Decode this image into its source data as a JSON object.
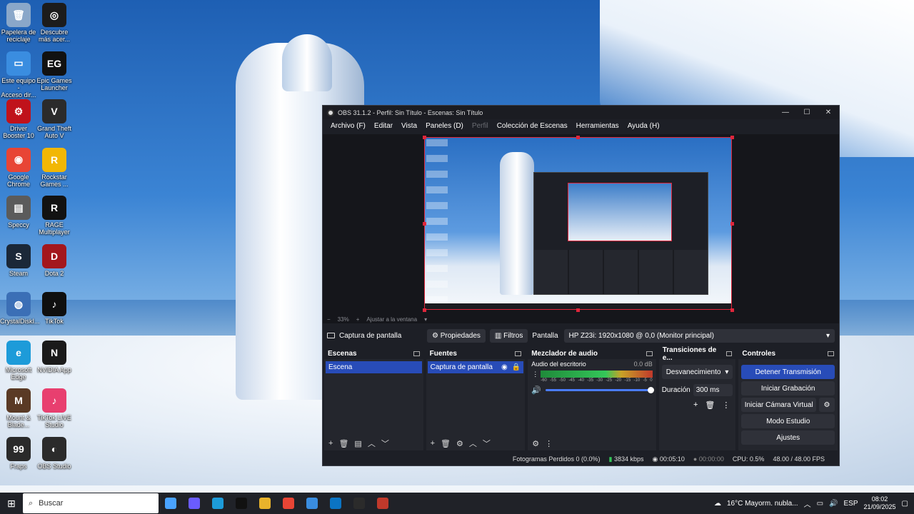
{
  "desktop": {
    "icons": [
      {
        "label": "Papelera de\nreciclaje",
        "color": "#8aa7c9",
        "glyph": "🗑"
      },
      {
        "label": "Descubre\nmás acer...",
        "color": "#1c1c1c",
        "glyph": "◎"
      },
      {
        "label": "Este equipo -\nAcceso dir...",
        "color": "#3a8de0",
        "glyph": "▭"
      },
      {
        "label": "Epic Games\nLauncher",
        "color": "#111111",
        "glyph": "EG"
      },
      {
        "label": "Driver\nBooster 10",
        "color": "#c0121b",
        "glyph": "⚙"
      },
      {
        "label": "Grand Theft\nAuto V",
        "color": "#2b2b2b",
        "glyph": "V"
      },
      {
        "label": "Google\nChrome",
        "color": "#e84535",
        "glyph": "◉"
      },
      {
        "label": "Rockstar\nGames ...",
        "color": "#f2b705",
        "glyph": "R"
      },
      {
        "label": "Speccy",
        "color": "#5b5b5b",
        "glyph": "▤"
      },
      {
        "label": "RAGE\nMultiplayer",
        "color": "#121212",
        "glyph": "R"
      },
      {
        "label": "Steam",
        "color": "#1b2838",
        "glyph": "S"
      },
      {
        "label": "Dota 2",
        "color": "#a3171d",
        "glyph": "D"
      },
      {
        "label": "CrystalDiskI...",
        "color": "#3b6fb6",
        "glyph": "◍"
      },
      {
        "label": "TikTok",
        "color": "#0f0f0f",
        "glyph": "♪"
      },
      {
        "label": "Microsoft\nEdge",
        "color": "#1d9bd9",
        "glyph": "e"
      },
      {
        "label": "NVIDIA App",
        "color": "#1a1a1a",
        "glyph": "N"
      },
      {
        "label": "Mount &\nBlade...",
        "color": "#5a3a25",
        "glyph": "M"
      },
      {
        "label": "TikTok LIVE\nStudio",
        "color": "#e83f6f",
        "glyph": "♪"
      },
      {
        "label": "Fraps",
        "color": "#2a2a2a",
        "glyph": "99"
      },
      {
        "label": "OBS Studio",
        "color": "#2b2b2b",
        "glyph": "◐"
      }
    ]
  },
  "obs": {
    "title": "OBS 31.1.2 - Perfil: Sin Título - Escenas: Sin Título",
    "menu": [
      "Archivo (F)",
      "Editar",
      "Vista",
      "Paneles (D)",
      "Perfil",
      "Colección de Escenas",
      "Herramientas",
      "Ayuda (H)"
    ],
    "zoom": {
      "minus": "−",
      "value": "33%",
      "plus": "+",
      "fit": "Ajustar a la ventana",
      "arrow": "▾"
    },
    "source_bar": {
      "source_name": "Captura de pantalla",
      "properties": "Propiedades",
      "filters": "Filtros",
      "display_label": "Pantalla",
      "display_value": "HP Z23i: 1920x1080 @ 0,0 (Monitor principal)"
    },
    "scenes": {
      "title": "Escenas",
      "items": [
        "Escena"
      ]
    },
    "sources": {
      "title": "Fuentes",
      "items": [
        "Captura de pantalla"
      ]
    },
    "mixer": {
      "title": "Mezclador de audio",
      "channel": "Audio del escritorio",
      "level": "0.0 dB",
      "scale": [
        "-60",
        "-55",
        "-50",
        "-45",
        "-40",
        "-35",
        "-30",
        "-25",
        "-20",
        "-15",
        "-10",
        "-5",
        "0"
      ]
    },
    "transitions": {
      "title": "Transiciones de e...",
      "type": "Desvanecimiento",
      "duration_label": "Duración",
      "duration": "300 ms"
    },
    "controls": {
      "title": "Controles",
      "stop_stream": "Detener Transmisión",
      "start_recording": "Iniciar Grabación",
      "start_virtual_cam": "Iniciar Cámara Virtual",
      "studio_mode": "Modo Estudio",
      "settings": "Ajustes"
    },
    "status": {
      "dropped": "Fotogramas Perdidos 0 (0.0%)",
      "bitrate": "3834 kbps",
      "stream_time": "00:05:10",
      "rec_time": "00:00:00",
      "cpu": "CPU: 0.5%",
      "fps": "48.00 / 48.00 FPS"
    }
  },
  "taskbar": {
    "search_placeholder": "Buscar",
    "apps": [
      "#4aa3ff",
      "#6a5cff",
      "#1d9bd9",
      "#111111",
      "#e9b32b",
      "#e84535",
      "#3a8de0",
      "#0b74c4",
      "#2b2b2b",
      "#c0392b"
    ],
    "weather": "16°C  Mayorm. nubla...",
    "lang": "ESP",
    "time": "08:02",
    "date": "21/09/2025"
  }
}
